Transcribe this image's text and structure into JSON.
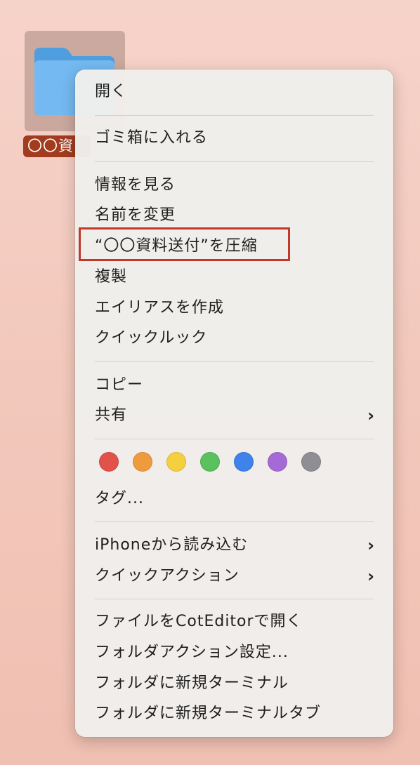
{
  "desktop": {
    "icon_label": "〇〇資"
  },
  "menu": {
    "open": "開く",
    "trash": "ゴミ箱に入れる",
    "get_info": "情報を見る",
    "rename": "名前を変更",
    "compress": "“〇〇資料送付”を圧縮",
    "duplicate": "複製",
    "make_alias": "エイリアスを作成",
    "quick_look": "クイックルック",
    "copy": "コピー",
    "share": "共有",
    "tags": "タグ...",
    "import_iphone": "iPhoneから読み込む",
    "quick_actions": "クイックアクション",
    "open_coteditor": "ファイルをCotEditorで開く",
    "folder_actions": "フォルダアクション設定...",
    "new_terminal": "フォルダに新規ターミナル",
    "new_terminal_tab": "フォルダに新規ターミナルタブ"
  },
  "tag_colors": [
    {
      "name": "red",
      "hex": "#e2524a"
    },
    {
      "name": "orange",
      "hex": "#f09a3e"
    },
    {
      "name": "yellow",
      "hex": "#f4d03f"
    },
    {
      "name": "green",
      "hex": "#5bc05e"
    },
    {
      "name": "blue",
      "hex": "#3f82ec"
    },
    {
      "name": "purple",
      "hex": "#a66ad6"
    },
    {
      "name": "gray",
      "hex": "#8e8e93"
    }
  ],
  "highlight_color": "#c0392b"
}
